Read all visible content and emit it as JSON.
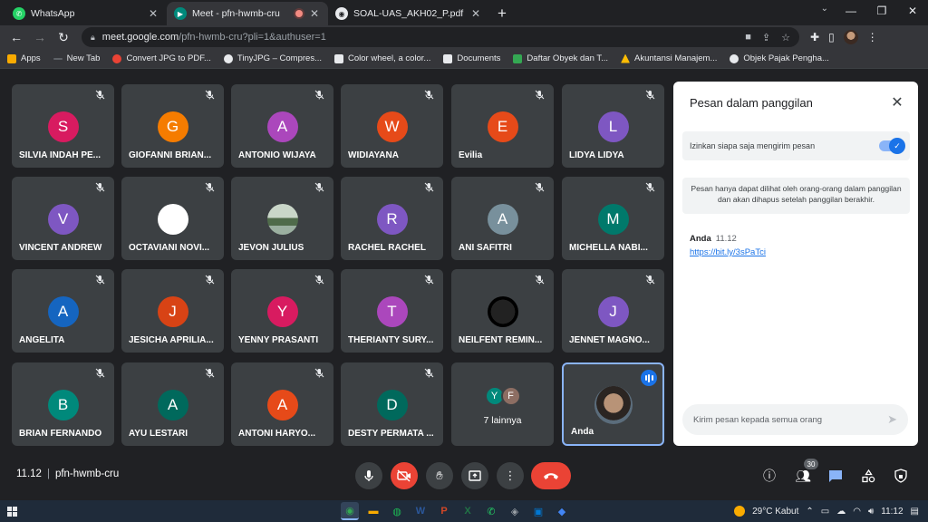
{
  "browser": {
    "tabs": [
      {
        "title": "WhatsApp",
        "active": false,
        "fav_color": "#25d366",
        "fav_glyph": "✆"
      },
      {
        "title": "Meet - pfn-hwmb-cru",
        "active": true,
        "fav_color": "#00897b",
        "fav_glyph": "▶"
      },
      {
        "title": "SOAL-UAS_AKH02_P.pdf",
        "active": false,
        "fav_color": "#e8eaed",
        "fav_glyph": "◉"
      }
    ],
    "url_host": "meet.google.com",
    "url_path": "/pfn-hwmb-cru?pli=1&authuser=1",
    "bookmarks": [
      {
        "label": "Apps",
        "color": "#f9ab00"
      },
      {
        "label": "New Tab",
        "color": "#9aa0a6"
      },
      {
        "label": "Convert JPG to PDF...",
        "color": "#ea4335"
      },
      {
        "label": "TinyJPG – Compres...",
        "color": "#e8eaed"
      },
      {
        "label": "Color wheel, a color...",
        "color": "#e8eaed"
      },
      {
        "label": "Documents",
        "color": "#e8eaed"
      },
      {
        "label": "Daftar Obyek dan T...",
        "color": "#34a853"
      },
      {
        "label": "Akuntansi Manajem...",
        "color": "#fbbc04"
      },
      {
        "label": "Objek Pajak Pengha...",
        "color": "#e8eaed"
      }
    ]
  },
  "participants": [
    {
      "initial": "S",
      "name": "SILVIA INDAH PE...",
      "color": "#d81b60"
    },
    {
      "initial": "G",
      "name": "GIOFANNI BRIAN...",
      "color": "#f57c00"
    },
    {
      "initial": "A",
      "name": "ANTONIO WIJAYA",
      "color": "#ab47bc"
    },
    {
      "initial": "W",
      "name": "WIDIAYANA",
      "color": "#e64a19"
    },
    {
      "initial": "E",
      "name": "Evilia",
      "color": "#e64a19"
    },
    {
      "initial": "L",
      "name": "LIDYA LIDYA",
      "color": "#7e57c2"
    },
    {
      "initial": "V",
      "name": "VINCENT ANDREW",
      "color": "#7e57c2"
    },
    {
      "initial": "",
      "name": "OCTAVIANI NOVI...",
      "color": "#ffffff"
    },
    {
      "initial": "",
      "name": "JEVON JULIUS",
      "color": "#7a8a78"
    },
    {
      "initial": "R",
      "name": "RACHEL RACHEL",
      "color": "#7e57c2"
    },
    {
      "initial": "A",
      "name": "ANI SAFITRI",
      "color": "#78909c"
    },
    {
      "initial": "M",
      "name": "MICHELLA NABI...",
      "color": "#00796b"
    },
    {
      "initial": "A",
      "name": "ANGELITA",
      "color": "#1565c0"
    },
    {
      "initial": "J",
      "name": "JESICHA APRILIA...",
      "color": "#d84315"
    },
    {
      "initial": "Y",
      "name": "YENNY PRASANTI",
      "color": "#d81b60"
    },
    {
      "initial": "T",
      "name": "THERIANTY SURY...",
      "color": "#ab47bc"
    },
    {
      "initial": "",
      "name": "NEILFENT REMIN...",
      "color": "#111111"
    },
    {
      "initial": "J",
      "name": "JENNET MAGNO...",
      "color": "#7e57c2"
    },
    {
      "initial": "B",
      "name": "BRIAN FERNANDO",
      "color": "#00897b"
    },
    {
      "initial": "A",
      "name": "AYU LESTARI",
      "color": "#00695c"
    },
    {
      "initial": "A",
      "name": "ANTONI HARYO...",
      "color": "#e64a19"
    },
    {
      "initial": "D",
      "name": "DESTY PERMATA ...",
      "color": "#00695c"
    }
  ],
  "more_tile": {
    "label": "7 lainnya",
    "avatars": [
      {
        "initial": "Y",
        "color": "#00897b"
      },
      {
        "initial": "F",
        "color": "#8d6e63"
      }
    ]
  },
  "self_tile": {
    "name": "Anda"
  },
  "chat": {
    "title": "Pesan dalam panggilan",
    "toggle_label": "Izinkan siapa saja mengirim pesan",
    "notice": "Pesan hanya dapat dilihat oleh orang-orang dalam panggilan dan akan dihapus setelah panggilan berakhir.",
    "message": {
      "sender": "Anda",
      "time": "11.12",
      "text": "https://bit.ly/3sPaTci"
    },
    "input_placeholder": "Kirim pesan kepada semua orang"
  },
  "controls": {
    "time": "11.12",
    "meeting_code": "pfn-hwmb-cru",
    "people_count": "30"
  },
  "taskbar": {
    "weather": "29°C  Kabut",
    "clock": "11:12",
    "apps": [
      {
        "glyph": "◉",
        "color": "#34a853",
        "active": true
      },
      {
        "glyph": "▬",
        "color": "#f9ab00",
        "active": false
      },
      {
        "glyph": "◍",
        "color": "#1db954",
        "active": false
      },
      {
        "glyph": "W",
        "color": "#2b579a",
        "active": false
      },
      {
        "glyph": "P",
        "color": "#d24726",
        "active": false
      },
      {
        "glyph": "X",
        "color": "#217346",
        "active": false
      },
      {
        "glyph": "✆",
        "color": "#25d366",
        "active": false
      },
      {
        "glyph": "◈",
        "color": "#9aa0a6",
        "active": false
      },
      {
        "glyph": "▣",
        "color": "#0078d4",
        "active": false
      },
      {
        "glyph": "◆",
        "color": "#4285f4",
        "active": false
      }
    ]
  }
}
